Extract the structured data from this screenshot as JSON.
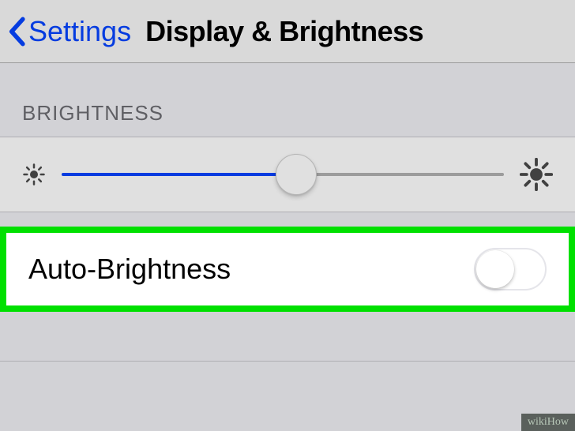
{
  "navbar": {
    "back_label": "Settings",
    "title": "Display & Brightness"
  },
  "brightness": {
    "section_header": "BRIGHTNESS",
    "slider_percent": 53,
    "auto_label": "Auto-Brightness",
    "auto_on": false
  },
  "watermark": "wikiHow",
  "colors": {
    "accent": "#0645ff",
    "highlight": "#00e000"
  }
}
